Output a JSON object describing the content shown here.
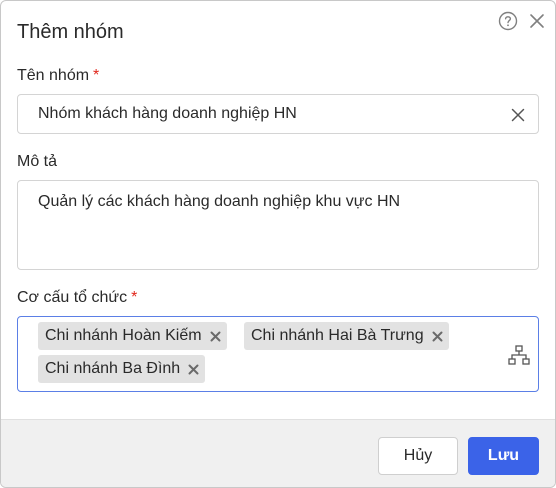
{
  "dialog": {
    "title": "Thêm nhóm",
    "icons": {
      "help": "help-circle-icon",
      "close": "close-icon"
    }
  },
  "form": {
    "name": {
      "label": "Tên nhóm",
      "required_mark": "*",
      "value": "Nhóm khách hàng doanh nghiệp HN"
    },
    "description": {
      "label": "Mô tả",
      "value": "Quản lý các khách hàng doanh nghiệp khu vực HN"
    },
    "org": {
      "label": "Cơ cấu tổ chức",
      "required_mark": "*",
      "tags": [
        "Chi nhánh Hoàn Kiếm",
        "Chi nhánh Hai Bà Trưng",
        "Chi nhánh Ba Đình"
      ],
      "picker_icon": "org-tree-icon"
    }
  },
  "footer": {
    "cancel_label": "Hủy",
    "save_label": "Lưu"
  },
  "colors": {
    "primary": "#3b63e8",
    "required": "#e0261b",
    "tag_bg": "#e2e2e2",
    "footer_bg": "#f0f0f0"
  }
}
